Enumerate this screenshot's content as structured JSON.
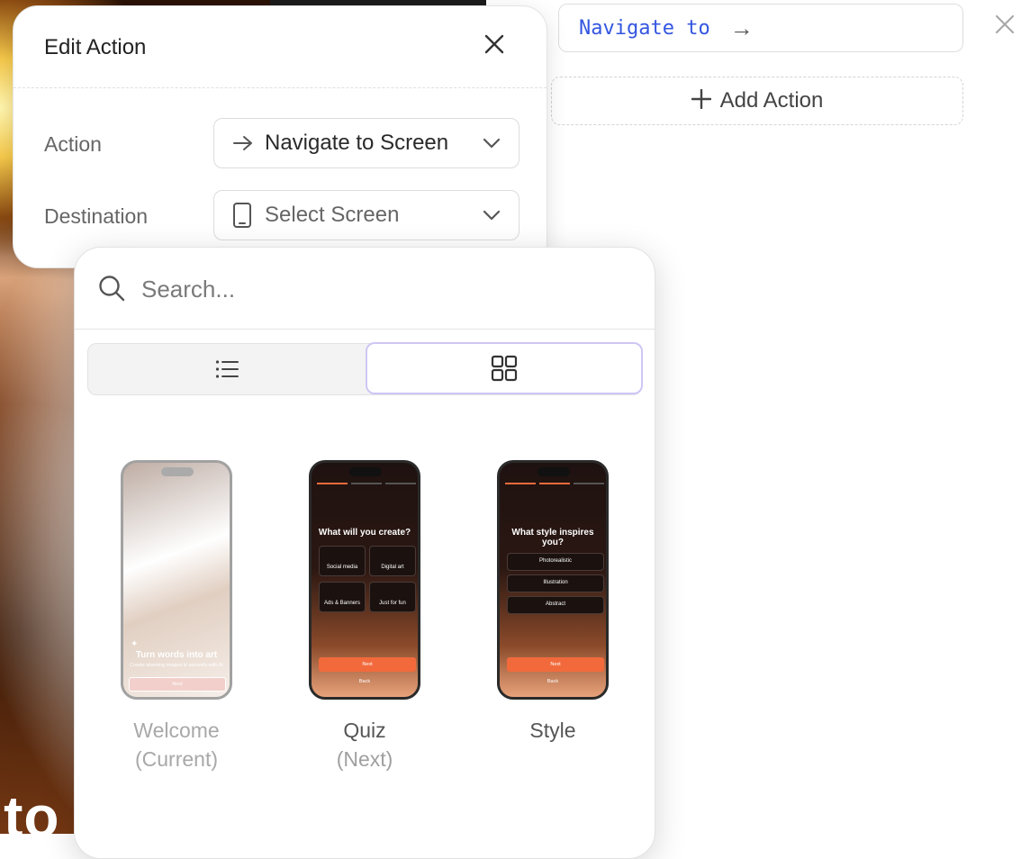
{
  "background": {
    "big_text": "nto"
  },
  "action_list": {
    "current_action_text": "Navigate to",
    "add_action_label": "Add Action"
  },
  "edit_action": {
    "title": "Edit Action",
    "action_label": "Action",
    "action_value": "Navigate to Screen",
    "destination_label": "Destination",
    "destination_placeholder": "Select Screen"
  },
  "picker": {
    "search_placeholder": "Search...",
    "view_mode": "grid",
    "screens": [
      {
        "name": "Welcome",
        "tag": "(Current)",
        "preview": {
          "title": "Turn words into art",
          "subtitle": "Create stunning images in seconds with AI",
          "button": "Next"
        }
      },
      {
        "name": "Quiz",
        "tag": "(Next)",
        "preview": {
          "question": "What will you create?",
          "options": [
            "Social media",
            "Digital art",
            "Ads & Banners",
            "Just for fun"
          ],
          "next": "Next",
          "back": "Back"
        }
      },
      {
        "name": "Style",
        "tag": "",
        "preview": {
          "question": "What style inspires you?",
          "options": [
            "Photorealistic",
            "Illustration",
            "Abstract"
          ],
          "next": "Next",
          "back": "Back"
        }
      }
    ]
  },
  "colors": {
    "accent_link": "#3355e0",
    "brand_orange": "#f26a3c",
    "selected_border": "#cfc6f5"
  }
}
